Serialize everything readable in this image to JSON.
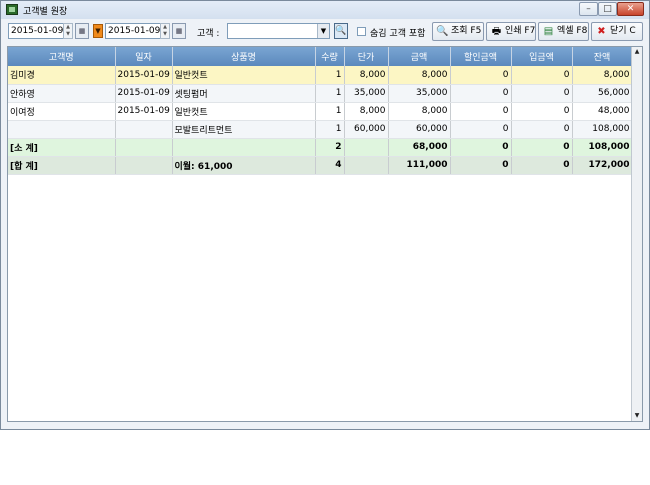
{
  "window": {
    "title": "고객별 원장"
  },
  "toolbar": {
    "date_from": "2015-01-09",
    "date_to": "2015-01-09",
    "customer_label": "고객 :",
    "customer_value": "",
    "include_hidden_label": "숨김 고객 포함",
    "buttons": {
      "search": "조회 F5",
      "print": "인쇄 F7",
      "excel": "엑셀 F8",
      "close": "닫기 C"
    }
  },
  "table": {
    "columns": [
      "고객명",
      "일자",
      "상품명",
      "수량",
      "단가",
      "금액",
      "할인금액",
      "입금액",
      "잔액"
    ],
    "rows": [
      {
        "customer": "김미경",
        "date": "2015-01-09",
        "product": "일반컷트",
        "qty": "1",
        "price": "8,000",
        "amount": "8,000",
        "discount": "0",
        "paid": "0",
        "balance": "8,000"
      },
      {
        "customer": "안하영",
        "date": "2015-01-09",
        "product": "셋팅펌머",
        "qty": "1",
        "price": "35,000",
        "amount": "35,000",
        "discount": "0",
        "paid": "0",
        "balance": "56,000"
      },
      {
        "customer": "이여정",
        "date": "2015-01-09",
        "product": "일반컷트",
        "qty": "1",
        "price": "8,000",
        "amount": "8,000",
        "discount": "0",
        "paid": "0",
        "balance": "48,000"
      },
      {
        "customer": "",
        "date": "",
        "product": "모발트리트먼트",
        "qty": "1",
        "price": "60,000",
        "amount": "60,000",
        "discount": "0",
        "paid": "0",
        "balance": "108,000"
      }
    ],
    "subtotal": {
      "label": "[소 계]",
      "qty": "2",
      "amount": "68,000",
      "discount": "0",
      "paid": "0",
      "balance": "108,000"
    },
    "total": {
      "label": "[합 계]",
      "carryover": "이월: 61,000",
      "qty": "4",
      "amount": "111,000",
      "discount": "0",
      "paid": "0",
      "balance": "172,000"
    }
  }
}
